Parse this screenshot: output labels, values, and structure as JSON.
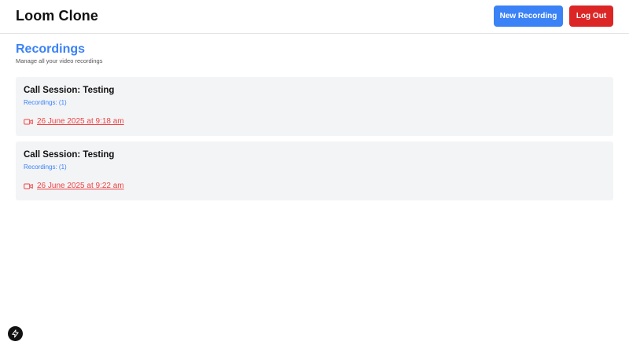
{
  "header": {
    "app_title": "Loom Clone",
    "new_recording_label": "New Recording",
    "logout_label": "Log Out"
  },
  "page": {
    "title": "Recordings",
    "subtitle": "Manage all your video recordings"
  },
  "sessions": [
    {
      "title": "Call Session: Testing",
      "recordings": "Recordings: (1)",
      "date": "26 June 2025 at 9:18 am"
    },
    {
      "title": "Call Session: Testing",
      "recordings": "Recordings: (1)",
      "date": "26 June 2025 at 9:22 am"
    }
  ],
  "icons": {
    "recording": "video-camera-icon",
    "dev_badge": "lightning-icon"
  },
  "colors": {
    "accent_blue": "#3b82f6",
    "danger_red": "#dc2626",
    "link_red": "#ef4444",
    "card_bg": "#f3f4f6"
  }
}
